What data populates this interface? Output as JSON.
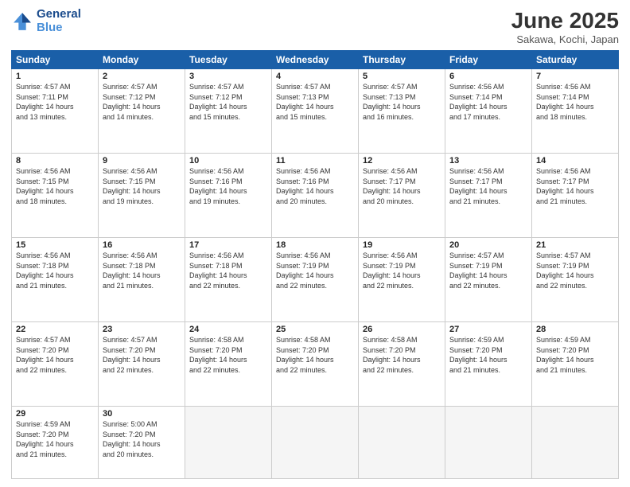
{
  "header": {
    "logo_line1": "General",
    "logo_line2": "Blue",
    "month": "June 2025",
    "location": "Sakawa, Kochi, Japan"
  },
  "weekdays": [
    "Sunday",
    "Monday",
    "Tuesday",
    "Wednesday",
    "Thursday",
    "Friday",
    "Saturday"
  ],
  "weeks": [
    [
      {
        "day": "1",
        "sunrise": "4:57 AM",
        "sunset": "7:11 PM",
        "daylight": "14 hours and 13 minutes."
      },
      {
        "day": "2",
        "sunrise": "4:57 AM",
        "sunset": "7:12 PM",
        "daylight": "14 hours and 14 minutes."
      },
      {
        "day": "3",
        "sunrise": "4:57 AM",
        "sunset": "7:12 PM",
        "daylight": "14 hours and 15 minutes."
      },
      {
        "day": "4",
        "sunrise": "4:57 AM",
        "sunset": "7:13 PM",
        "daylight": "14 hours and 15 minutes."
      },
      {
        "day": "5",
        "sunrise": "4:57 AM",
        "sunset": "7:13 PM",
        "daylight": "14 hours and 16 minutes."
      },
      {
        "day": "6",
        "sunrise": "4:56 AM",
        "sunset": "7:14 PM",
        "daylight": "14 hours and 17 minutes."
      },
      {
        "day": "7",
        "sunrise": "4:56 AM",
        "sunset": "7:14 PM",
        "daylight": "14 hours and 18 minutes."
      }
    ],
    [
      {
        "day": "8",
        "sunrise": "4:56 AM",
        "sunset": "7:15 PM",
        "daylight": "14 hours and 18 minutes."
      },
      {
        "day": "9",
        "sunrise": "4:56 AM",
        "sunset": "7:15 PM",
        "daylight": "14 hours and 19 minutes."
      },
      {
        "day": "10",
        "sunrise": "4:56 AM",
        "sunset": "7:16 PM",
        "daylight": "14 hours and 19 minutes."
      },
      {
        "day": "11",
        "sunrise": "4:56 AM",
        "sunset": "7:16 PM",
        "daylight": "14 hours and 20 minutes."
      },
      {
        "day": "12",
        "sunrise": "4:56 AM",
        "sunset": "7:17 PM",
        "daylight": "14 hours and 20 minutes."
      },
      {
        "day": "13",
        "sunrise": "4:56 AM",
        "sunset": "7:17 PM",
        "daylight": "14 hours and 21 minutes."
      },
      {
        "day": "14",
        "sunrise": "4:56 AM",
        "sunset": "7:17 PM",
        "daylight": "14 hours and 21 minutes."
      }
    ],
    [
      {
        "day": "15",
        "sunrise": "4:56 AM",
        "sunset": "7:18 PM",
        "daylight": "14 hours and 21 minutes."
      },
      {
        "day": "16",
        "sunrise": "4:56 AM",
        "sunset": "7:18 PM",
        "daylight": "14 hours and 21 minutes."
      },
      {
        "day": "17",
        "sunrise": "4:56 AM",
        "sunset": "7:18 PM",
        "daylight": "14 hours and 22 minutes."
      },
      {
        "day": "18",
        "sunrise": "4:56 AM",
        "sunset": "7:19 PM",
        "daylight": "14 hours and 22 minutes."
      },
      {
        "day": "19",
        "sunrise": "4:56 AM",
        "sunset": "7:19 PM",
        "daylight": "14 hours and 22 minutes."
      },
      {
        "day": "20",
        "sunrise": "4:57 AM",
        "sunset": "7:19 PM",
        "daylight": "14 hours and 22 minutes."
      },
      {
        "day": "21",
        "sunrise": "4:57 AM",
        "sunset": "7:19 PM",
        "daylight": "14 hours and 22 minutes."
      }
    ],
    [
      {
        "day": "22",
        "sunrise": "4:57 AM",
        "sunset": "7:20 PM",
        "daylight": "14 hours and 22 minutes."
      },
      {
        "day": "23",
        "sunrise": "4:57 AM",
        "sunset": "7:20 PM",
        "daylight": "14 hours and 22 minutes."
      },
      {
        "day": "24",
        "sunrise": "4:58 AM",
        "sunset": "7:20 PM",
        "daylight": "14 hours and 22 minutes."
      },
      {
        "day": "25",
        "sunrise": "4:58 AM",
        "sunset": "7:20 PM",
        "daylight": "14 hours and 22 minutes."
      },
      {
        "day": "26",
        "sunrise": "4:58 AM",
        "sunset": "7:20 PM",
        "daylight": "14 hours and 22 minutes."
      },
      {
        "day": "27",
        "sunrise": "4:59 AM",
        "sunset": "7:20 PM",
        "daylight": "14 hours and 21 minutes."
      },
      {
        "day": "28",
        "sunrise": "4:59 AM",
        "sunset": "7:20 PM",
        "daylight": "14 hours and 21 minutes."
      }
    ],
    [
      {
        "day": "29",
        "sunrise": "4:59 AM",
        "sunset": "7:20 PM",
        "daylight": "14 hours and 21 minutes."
      },
      {
        "day": "30",
        "sunrise": "5:00 AM",
        "sunset": "7:20 PM",
        "daylight": "14 hours and 20 minutes."
      },
      null,
      null,
      null,
      null,
      null
    ]
  ]
}
